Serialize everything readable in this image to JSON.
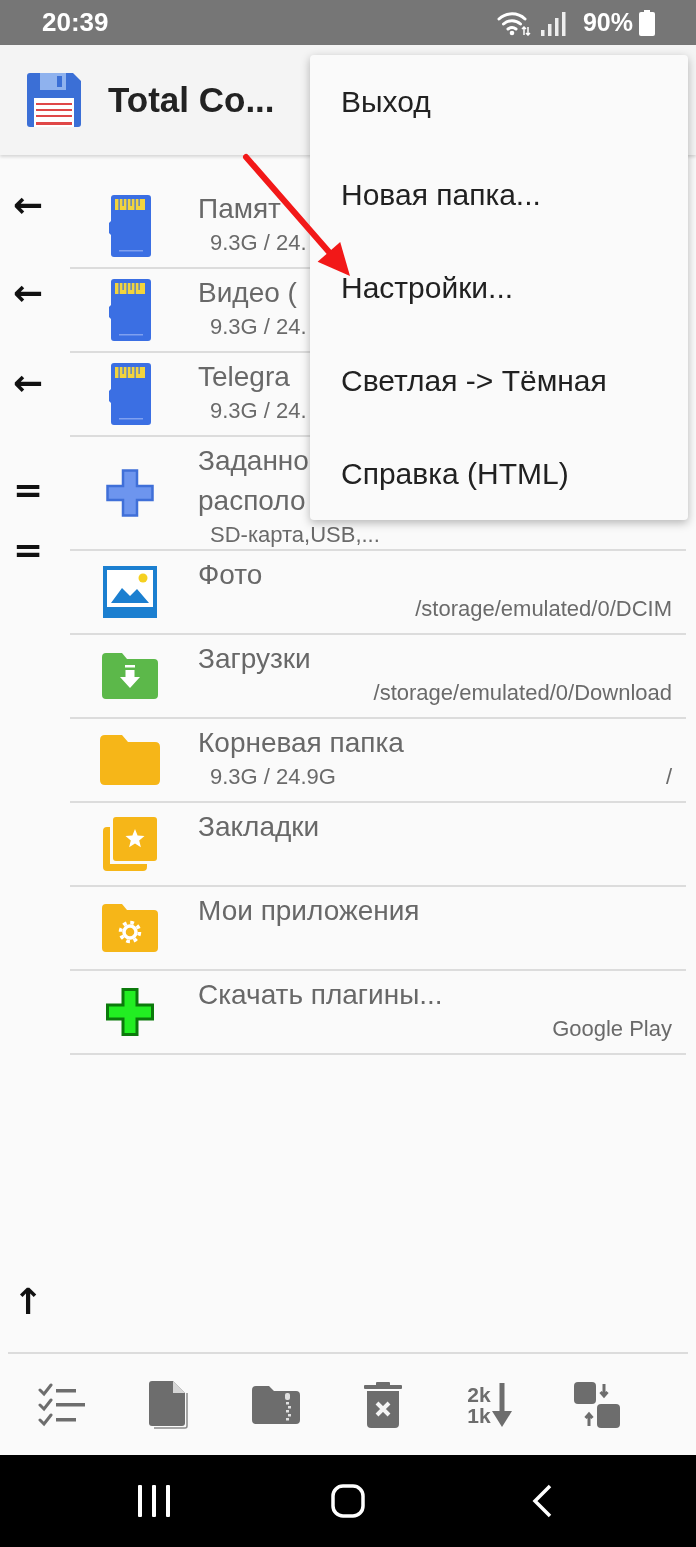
{
  "status_bar": {
    "time": "20:39",
    "battery": "90%"
  },
  "app_bar": {
    "title": "Total Co..."
  },
  "side_marks": [
    "←",
    "←",
    "←",
    "=",
    "="
  ],
  "up_mark": "↑",
  "rows": [
    {
      "kind": "storage",
      "title_lines": [
        "Памят"
      ],
      "subtitle_left": "9.3G / 24."
    },
    {
      "kind": "storage",
      "title_lines": [
        "Видео ("
      ],
      "subtitle_left": "9.3G / 24."
    },
    {
      "kind": "storage",
      "title_lines": [
        "Telegra"
      ],
      "subtitle_left": "9.3G / 24."
    },
    {
      "kind": "locations",
      "title_lines": [
        "Заданно",
        "располо"
      ],
      "subtitle_left": "SD-карта,USB,..."
    },
    {
      "kind": "photos",
      "title_lines": [
        "Фото"
      ],
      "subtitle_right": "/storage/emulated/0/DCIM"
    },
    {
      "kind": "downloads",
      "title_lines": [
        "Загрузки"
      ],
      "subtitle_right": "/storage/emulated/0/Download"
    },
    {
      "kind": "root",
      "title_lines": [
        "Корневая папка"
      ],
      "subtitle_left": "9.3G / 24.9G",
      "subtitle_right": "/"
    },
    {
      "kind": "bookmarks",
      "title_lines": [
        "Закладки"
      ]
    },
    {
      "kind": "apps",
      "title_lines": [
        "Мои приложения"
      ]
    },
    {
      "kind": "plugins",
      "title_lines": [
        "Скачать плагины..."
      ],
      "subtitle_right": "Google Play"
    }
  ],
  "menu": {
    "items": [
      {
        "label": "Выход"
      },
      {
        "label": "Новая папка..."
      },
      {
        "label": "Настройки..."
      },
      {
        "label": "Светлая -> Тёмная"
      },
      {
        "label": "Справка (HTML)"
      }
    ]
  },
  "toolbar": [
    {
      "kind": "select"
    },
    {
      "kind": "copy"
    },
    {
      "kind": "archive"
    },
    {
      "kind": "delete"
    },
    {
      "kind": "sort",
      "labels": [
        "2k",
        "1k"
      ]
    },
    {
      "kind": "swap"
    }
  ],
  "nav_bar": [
    {
      "kind": "recents"
    },
    {
      "kind": "home"
    },
    {
      "kind": "back"
    }
  ]
}
